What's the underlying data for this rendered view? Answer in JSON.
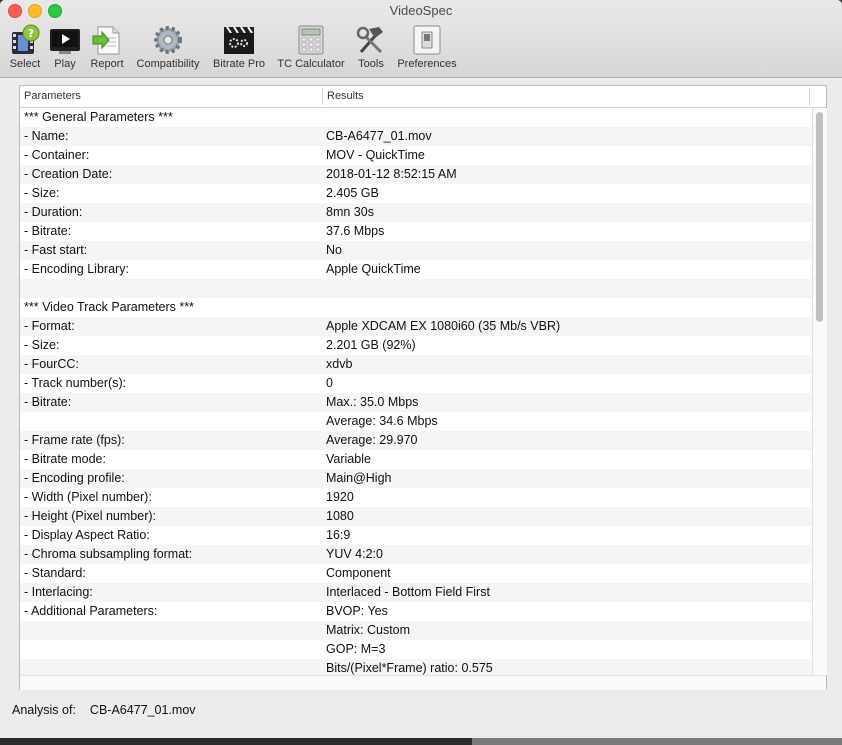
{
  "window": {
    "title": "VideoSpec"
  },
  "toolbar": [
    {
      "label": "Select",
      "icon": "film-select-icon"
    },
    {
      "label": "Play",
      "icon": "play-icon"
    },
    {
      "label": "Report",
      "icon": "report-icon"
    },
    {
      "label": "Compatibility",
      "icon": "gear-icon"
    },
    {
      "label": "Bitrate Pro",
      "icon": "clapper-icon"
    },
    {
      "label": "TC Calculator",
      "icon": "calculator-icon"
    },
    {
      "label": "Tools",
      "icon": "tools-icon"
    },
    {
      "label": "Preferences",
      "icon": "switch-icon"
    }
  ],
  "table": {
    "headers": [
      "Parameters",
      "Results"
    ],
    "rows": [
      [
        "*** General Parameters ***",
        ""
      ],
      [
        "- Name:",
        "CB-A6477_01.mov"
      ],
      [
        "- Container:",
        "MOV - QuickTime"
      ],
      [
        "- Creation Date:",
        "2018-01-12 8:52:15 AM"
      ],
      [
        "- Size:",
        "2.405 GB"
      ],
      [
        "- Duration:",
        "8mn 30s"
      ],
      [
        "- Bitrate:",
        "37.6 Mbps"
      ],
      [
        "- Fast start:",
        "No"
      ],
      [
        "- Encoding Library:",
        "Apple QuickTime"
      ],
      [
        "",
        ""
      ],
      [
        "*** Video Track Parameters ***",
        ""
      ],
      [
        "- Format:",
        "Apple XDCAM EX 1080i60 (35 Mb/s VBR)"
      ],
      [
        "- Size:",
        "2.201 GB (92%)"
      ],
      [
        "- FourCC:",
        "xdvb"
      ],
      [
        "- Track number(s):",
        "0"
      ],
      [
        "- Bitrate:",
        "Max.: 35.0 Mbps"
      ],
      [
        "",
        "Average: 34.6 Mbps"
      ],
      [
        "- Frame rate (fps):",
        "Average: 29.970"
      ],
      [
        "- Bitrate mode:",
        "Variable"
      ],
      [
        "- Encoding profile:",
        "Main@High"
      ],
      [
        "- Width (Pixel number):",
        "1920"
      ],
      [
        "- Height (Pixel number):",
        "1080"
      ],
      [
        "- Display Aspect Ratio:",
        "16:9"
      ],
      [
        "- Chroma subsampling format:",
        "YUV 4:2:0"
      ],
      [
        "- Standard:",
        "Component"
      ],
      [
        "- Interlacing:",
        "Interlaced - Bottom Field First"
      ],
      [
        "- Additional Parameters:",
        "BVOP: Yes"
      ],
      [
        "",
        "Matrix: Custom"
      ],
      [
        "",
        "GOP: M=3"
      ],
      [
        "",
        "Bits/(Pixel*Frame) ratio: 0.575"
      ]
    ]
  },
  "status": {
    "label": "Analysis of:",
    "filename": "CB-A6477_01.mov"
  }
}
